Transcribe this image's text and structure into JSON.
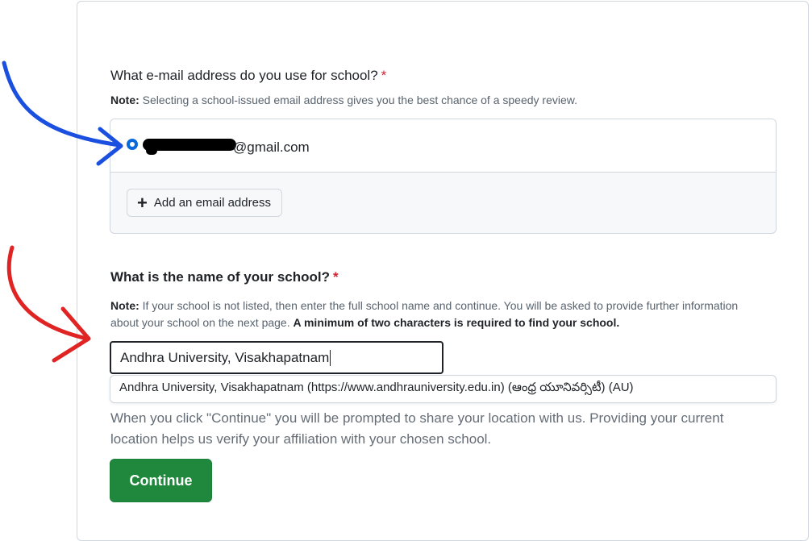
{
  "email_section": {
    "question": "What e-mail address do you use for school?",
    "required_mark": "*",
    "note_label": "Note:",
    "note_text": " Selecting a school-issued email address gives you the best chance of a speedy review.",
    "selected_email_domain": "@gmail.com",
    "add_email_label": "Add an email address"
  },
  "school_section": {
    "question": "What is the name of your school?",
    "required_mark": "*",
    "note_label": "Note:",
    "note_text": " If your school is not listed, then enter the full school name and continue. You will be asked to provide further information about your school on the next page. ",
    "note_bold": "A minimum of two characters is required to find your school.",
    "input_value": "Andhra University, Visakhapatnam",
    "suggestion": "Andhra University, Visakhapatnam (https://www.andhrauniversity.edu.in) (ఆంధ్ర యూనివర్సిటీ) (AU)"
  },
  "location_info": "When you click \"Continue\" you will be prompted to share your location with us. Providing your current location helps us verify your affiliation with your chosen school.",
  "continue_label": "Continue",
  "colors": {
    "accent_blue": "#0969da",
    "primary_green": "#1f883d",
    "required_red": "#d1242f",
    "annotation_blue": "#1a4fe0",
    "annotation_red": "#e02424"
  }
}
